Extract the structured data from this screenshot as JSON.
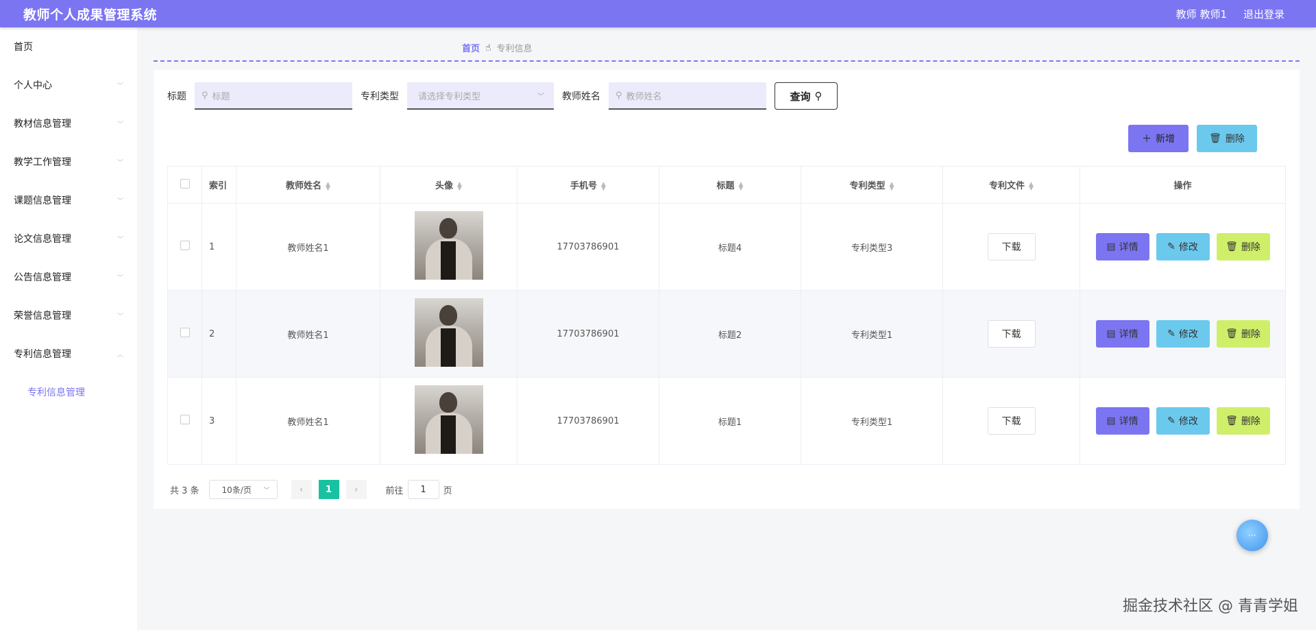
{
  "header": {
    "title": "教师个人成果管理系统",
    "user": "教师 教师1",
    "logout": "退出登录"
  },
  "sidebar": {
    "items": [
      {
        "label": "首页",
        "chevron": false
      },
      {
        "label": "个人中心",
        "chevron": true
      },
      {
        "label": "教材信息管理",
        "chevron": true
      },
      {
        "label": "教学工作管理",
        "chevron": true
      },
      {
        "label": "课题信息管理",
        "chevron": true
      },
      {
        "label": "论文信息管理",
        "chevron": true
      },
      {
        "label": "公告信息管理",
        "chevron": true
      },
      {
        "label": "荣誉信息管理",
        "chevron": true
      },
      {
        "label": "专利信息管理",
        "chevron": true,
        "expanded": true
      }
    ],
    "sub_item": "专利信息管理"
  },
  "breadcrumb": {
    "home": "首页",
    "current": "专利信息"
  },
  "filters": {
    "title_label": "标题",
    "title_placeholder": "标题",
    "type_label": "专利类型",
    "type_placeholder": "请选择专利类型",
    "teacher_label": "教师姓名",
    "teacher_placeholder": "教师姓名",
    "query": "查询"
  },
  "actions": {
    "add": "新增",
    "delete": "删除"
  },
  "table": {
    "headers": [
      "索引",
      "教师姓名",
      "头像",
      "手机号",
      "标题",
      "专利类型",
      "专利文件",
      "操作"
    ],
    "rows": [
      {
        "index": "1",
        "teacher": "教师姓名1",
        "phone": "17703786901",
        "title": "标题4",
        "type": "专利类型3"
      },
      {
        "index": "2",
        "teacher": "教师姓名1",
        "phone": "17703786901",
        "title": "标题2",
        "type": "专利类型1"
      },
      {
        "index": "3",
        "teacher": "教师姓名1",
        "phone": "17703786901",
        "title": "标题1",
        "type": "专利类型1"
      }
    ],
    "download": "下载",
    "detail": "详情",
    "edit": "修改",
    "remove": "删除"
  },
  "pager": {
    "total": "共 3 条",
    "size": "10条/页",
    "page": "1",
    "goto_prefix": "前往",
    "goto_value": "1",
    "goto_suffix": "页"
  },
  "watermark": "掘金技术社区 @ 青青学姐",
  "colors": {
    "accent": "#7b75f2",
    "info": "#6cc9ee",
    "warn": "#cfef6a",
    "page_active": "#19c1a2"
  }
}
